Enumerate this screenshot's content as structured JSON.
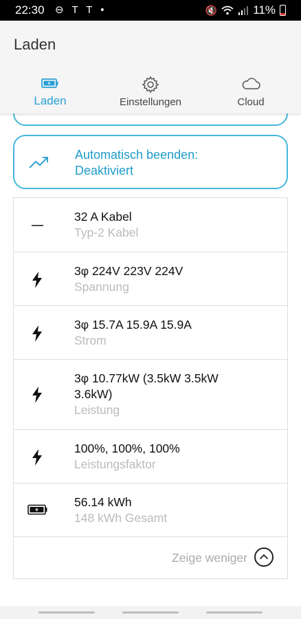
{
  "status_bar": {
    "time": "22:30",
    "battery_percent": "11%"
  },
  "app": {
    "title": "Laden"
  },
  "tabs": [
    {
      "label": "Laden",
      "icon": "battery-icon",
      "active": true
    },
    {
      "label": "Einstellungen",
      "icon": "gear-icon",
      "active": false
    },
    {
      "label": "Cloud",
      "icon": "cloud-icon",
      "active": false
    }
  ],
  "auto_stop": {
    "line1": "Automatisch beenden:",
    "line2": "Deaktiviert",
    "icon": "trending-up-icon"
  },
  "details": [
    {
      "icon": "dash-icon",
      "primary": "32 A Kabel",
      "secondary": "Typ-2 Kabel"
    },
    {
      "icon": "bolt-icon",
      "primary": "3φ 224V 223V 224V",
      "secondary": "Spannung"
    },
    {
      "icon": "bolt-icon",
      "primary": "3φ 15.7A 15.9A 15.9A",
      "secondary": "Strom"
    },
    {
      "icon": "bolt-icon",
      "primary_line1": "3φ 10.77kW (3.5kW 3.5kW",
      "primary_line2": "3.6kW)",
      "secondary": "Leistung"
    },
    {
      "icon": "bolt-icon",
      "primary": "100%, 100%, 100%",
      "secondary": "Leistungsfaktor"
    },
    {
      "icon": "battery-charging-icon",
      "primary": "56.14 kWh",
      "secondary": "148 kWh Gesamt"
    }
  ],
  "show_less": {
    "label": "Zeige weniger",
    "icon": "chevron-up-icon"
  },
  "colors": {
    "accent": "#2a9fd6",
    "card_border": "#45b7dd",
    "secondary_text": "#bbbbbb"
  }
}
